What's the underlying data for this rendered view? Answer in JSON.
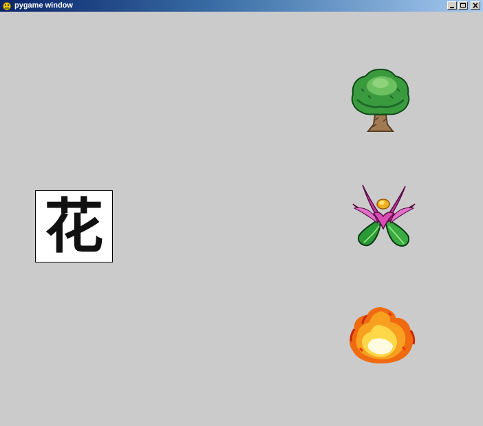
{
  "window": {
    "title": "pygame window"
  },
  "game": {
    "card": {
      "kanji": "花"
    },
    "choices": [
      {
        "name": "tree-icon"
      },
      {
        "name": "flower-icon"
      },
      {
        "name": "fire-icon"
      }
    ]
  },
  "colors": {
    "background": "#cbcbcb",
    "titlebar_start": "#0a246a",
    "titlebar_end": "#a6caf0"
  }
}
